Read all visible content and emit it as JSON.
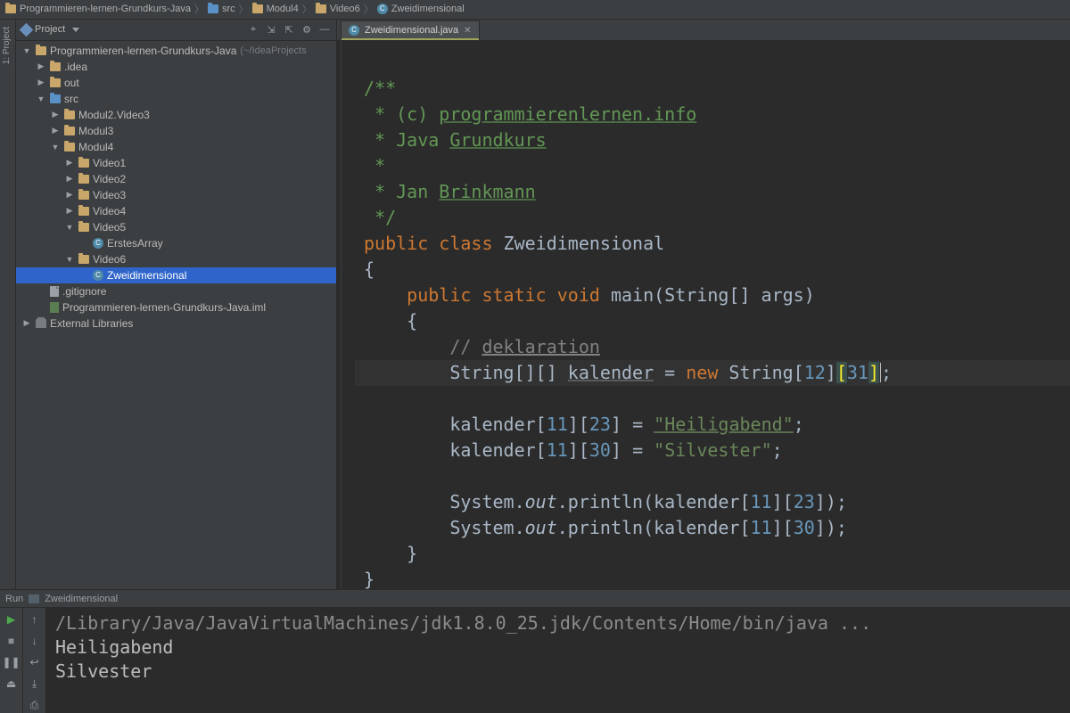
{
  "breadcrumb": {
    "items": [
      {
        "icon": "folder",
        "label": "Programmieren-lernen-Grundkurs-Java"
      },
      {
        "icon": "folder-blue",
        "label": "src"
      },
      {
        "icon": "folder",
        "label": "Modul4"
      },
      {
        "icon": "folder",
        "label": "Video6"
      },
      {
        "icon": "class",
        "label": "Zweidimensional"
      }
    ]
  },
  "left_gutter_label": "1: Project",
  "project_panel": {
    "title": "Project",
    "toolbar": [
      "target",
      "autoscroll",
      "collapse",
      "settings",
      "hide"
    ]
  },
  "tree": [
    {
      "depth": 0,
      "exp": "▼",
      "icon": "folder",
      "label": "Programmieren-lernen-Grundkurs-Java",
      "note": "(~/IdeaProjects"
    },
    {
      "depth": 1,
      "exp": "▶",
      "icon": "folder",
      "label": ".idea"
    },
    {
      "depth": 1,
      "exp": "▶",
      "icon": "folder",
      "label": "out"
    },
    {
      "depth": 1,
      "exp": "▼",
      "icon": "folder-blue",
      "label": "src"
    },
    {
      "depth": 2,
      "exp": "▶",
      "icon": "folder",
      "label": "Modul2.Video3"
    },
    {
      "depth": 2,
      "exp": "▶",
      "icon": "folder",
      "label": "Modul3"
    },
    {
      "depth": 2,
      "exp": "▼",
      "icon": "folder",
      "label": "Modul4"
    },
    {
      "depth": 3,
      "exp": "▶",
      "icon": "folder",
      "label": "Video1"
    },
    {
      "depth": 3,
      "exp": "▶",
      "icon": "folder",
      "label": "Video2"
    },
    {
      "depth": 3,
      "exp": "▶",
      "icon": "folder",
      "label": "Video3"
    },
    {
      "depth": 3,
      "exp": "▶",
      "icon": "folder",
      "label": "Video4"
    },
    {
      "depth": 3,
      "exp": "▼",
      "icon": "folder",
      "label": "Video5"
    },
    {
      "depth": 4,
      "exp": "",
      "icon": "class",
      "label": "ErstesArray"
    },
    {
      "depth": 3,
      "exp": "▼",
      "icon": "folder",
      "label": "Video6"
    },
    {
      "depth": 4,
      "exp": "",
      "icon": "class",
      "label": "Zweidimensional",
      "selected": true
    },
    {
      "depth": 1,
      "exp": "",
      "icon": "file",
      "label": ".gitignore"
    },
    {
      "depth": 1,
      "exp": "",
      "icon": "iml",
      "label": "Programmieren-lernen-Grundkurs-Java.iml"
    },
    {
      "depth": 0,
      "exp": "▶",
      "icon": "lib",
      "label": "External Libraries"
    }
  ],
  "editor": {
    "tab": {
      "label": "Zweidimensional.java"
    },
    "lines": [
      {
        "t": "blank"
      },
      {
        "t": "doc",
        "text": "/**"
      },
      {
        "t": "doc-u",
        "prefix": " * (c) ",
        "u": "programmierenlernen.info"
      },
      {
        "t": "doc-u",
        "prefix": " * Java ",
        "u": "Grundkurs"
      },
      {
        "t": "doc",
        "text": " *"
      },
      {
        "t": "doc-u",
        "prefix": " * Jan ",
        "u": "Brinkmann"
      },
      {
        "t": "doc",
        "text": " */"
      },
      {
        "t": "class-decl",
        "kw1": "public",
        "kw2": "class",
        "name": "Zweidimensional"
      },
      {
        "t": "plain",
        "text": "{"
      },
      {
        "t": "main-decl",
        "indent": "    ",
        "kw": "public static void",
        "name": "main",
        "args": "(String[] args)"
      },
      {
        "t": "plain",
        "text": "    {"
      },
      {
        "t": "cmt",
        "indent": "        ",
        "slashes": "// ",
        "u": "deklaration"
      },
      {
        "t": "decl-new",
        "hl": true,
        "indent": "        ",
        "lhs": "String[][] ",
        "uvar": "kalender",
        "mid": " = ",
        "kw": "new",
        "after": " String",
        "b1": "[",
        "n1": "12",
        "b2": "]",
        "hl_open": "[",
        "n2": "31",
        "hl_close": "]",
        "tail": ";"
      },
      {
        "t": "blank"
      },
      {
        "t": "assign",
        "indent": "        ",
        "lhs": "kalender[",
        "n1": "11",
        "mid": "][",
        "n2": "23",
        "rhs": "] = ",
        "stru": "\"Heiligabend\"",
        "tail": ";"
      },
      {
        "t": "assign",
        "indent": "        ",
        "lhs": "kalender[",
        "n1": "11",
        "mid": "][",
        "n2": "30",
        "rhs": "] = ",
        "str": "\"Silvester\"",
        "tail": ";"
      },
      {
        "t": "blank"
      },
      {
        "t": "print",
        "indent": "        ",
        "pre": "System.",
        "out": "out",
        "post": ".println(kalender[",
        "n1": "11",
        "mid": "][",
        "n2": "23",
        "tail": "]);"
      },
      {
        "t": "print",
        "indent": "        ",
        "pre": "System.",
        "out": "out",
        "post": ".println(kalender[",
        "n1": "11",
        "mid": "][",
        "n2": "30",
        "tail": "]);"
      },
      {
        "t": "plain",
        "text": "    }"
      },
      {
        "t": "plain",
        "text": "}"
      }
    ]
  },
  "run": {
    "header_prefix": "Run",
    "header_name": "Zweidimensional",
    "cmd": "/Library/Java/JavaVirtualMachines/jdk1.8.0_25.jdk/Contents/Home/bin/java ...",
    "out1": "Heiligabend",
    "out2": "Silvester"
  }
}
